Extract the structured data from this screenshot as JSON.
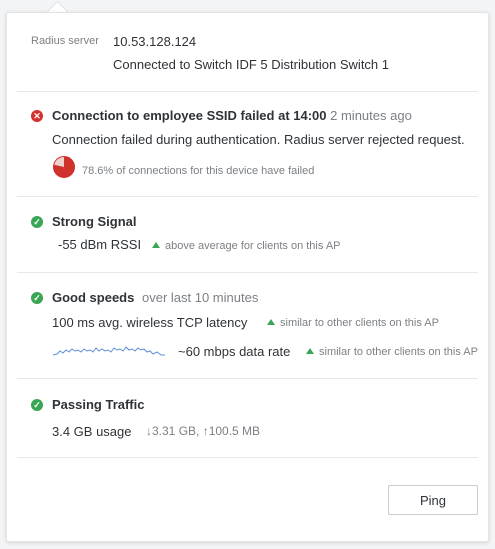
{
  "server": {
    "label": "Radius server",
    "ip": "10.53.128.124",
    "connection": "Connected to Switch IDF 5 Distribution Switch 1"
  },
  "failure": {
    "title": "Connection to employee SSID failed at 14:00",
    "time_ago": "2 minutes ago",
    "detail": "Connection failed during authentication. Radius server rejected request.",
    "stat_text": "78.6% of connections for this device have failed",
    "failed_fraction": 0.786
  },
  "signal": {
    "title": "Strong Signal",
    "value": "-55 dBm RSSI",
    "note": "above average for clients on this AP"
  },
  "speeds": {
    "title": "Good speeds",
    "period": "over last 10 minutes",
    "latency": "100 ms avg. wireless TCP latency",
    "latency_note": "similar to other clients on this AP",
    "rate": "~60 mbps data rate",
    "rate_note": "similar to other clients on this AP"
  },
  "traffic": {
    "title": "Passing Traffic",
    "usage": "3.4 GB usage",
    "breakdown": "↓3.31 GB, ↑100.5 MB"
  },
  "actions": {
    "ping": "Ping"
  },
  "colors": {
    "ok": "#3aa655",
    "error": "#d0312d",
    "sparkline": "#5b8fd6"
  },
  "icons": {
    "ok": "check-circle-icon",
    "error": "x-circle-icon",
    "pie": "pie-chart-icon"
  }
}
